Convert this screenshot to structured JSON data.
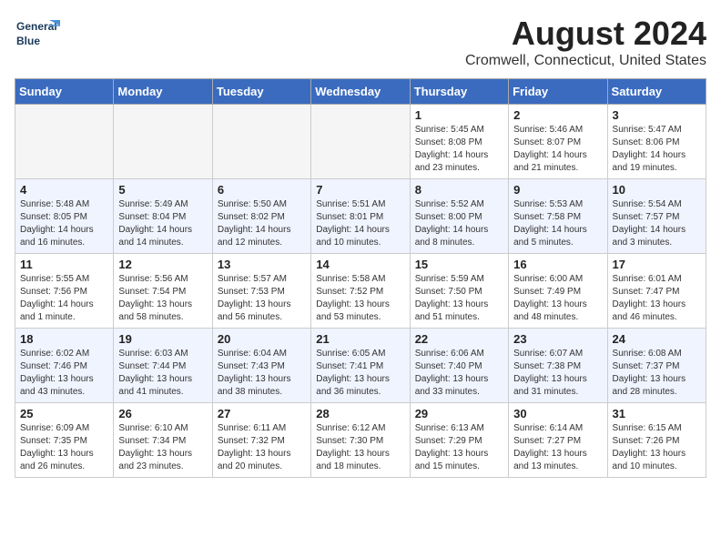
{
  "header": {
    "logo_line1": "General",
    "logo_line2": "Blue",
    "month_year": "August 2024",
    "location": "Cromwell, Connecticut, United States"
  },
  "weekdays": [
    "Sunday",
    "Monday",
    "Tuesday",
    "Wednesday",
    "Thursday",
    "Friday",
    "Saturday"
  ],
  "weeks": [
    [
      {
        "day": "",
        "info": ""
      },
      {
        "day": "",
        "info": ""
      },
      {
        "day": "",
        "info": ""
      },
      {
        "day": "",
        "info": ""
      },
      {
        "day": "1",
        "info": "Sunrise: 5:45 AM\nSunset: 8:08 PM\nDaylight: 14 hours\nand 23 minutes."
      },
      {
        "day": "2",
        "info": "Sunrise: 5:46 AM\nSunset: 8:07 PM\nDaylight: 14 hours\nand 21 minutes."
      },
      {
        "day": "3",
        "info": "Sunrise: 5:47 AM\nSunset: 8:06 PM\nDaylight: 14 hours\nand 19 minutes."
      }
    ],
    [
      {
        "day": "4",
        "info": "Sunrise: 5:48 AM\nSunset: 8:05 PM\nDaylight: 14 hours\nand 16 minutes."
      },
      {
        "day": "5",
        "info": "Sunrise: 5:49 AM\nSunset: 8:04 PM\nDaylight: 14 hours\nand 14 minutes."
      },
      {
        "day": "6",
        "info": "Sunrise: 5:50 AM\nSunset: 8:02 PM\nDaylight: 14 hours\nand 12 minutes."
      },
      {
        "day": "7",
        "info": "Sunrise: 5:51 AM\nSunset: 8:01 PM\nDaylight: 14 hours\nand 10 minutes."
      },
      {
        "day": "8",
        "info": "Sunrise: 5:52 AM\nSunset: 8:00 PM\nDaylight: 14 hours\nand 8 minutes."
      },
      {
        "day": "9",
        "info": "Sunrise: 5:53 AM\nSunset: 7:58 PM\nDaylight: 14 hours\nand 5 minutes."
      },
      {
        "day": "10",
        "info": "Sunrise: 5:54 AM\nSunset: 7:57 PM\nDaylight: 14 hours\nand 3 minutes."
      }
    ],
    [
      {
        "day": "11",
        "info": "Sunrise: 5:55 AM\nSunset: 7:56 PM\nDaylight: 14 hours\nand 1 minute."
      },
      {
        "day": "12",
        "info": "Sunrise: 5:56 AM\nSunset: 7:54 PM\nDaylight: 13 hours\nand 58 minutes."
      },
      {
        "day": "13",
        "info": "Sunrise: 5:57 AM\nSunset: 7:53 PM\nDaylight: 13 hours\nand 56 minutes."
      },
      {
        "day": "14",
        "info": "Sunrise: 5:58 AM\nSunset: 7:52 PM\nDaylight: 13 hours\nand 53 minutes."
      },
      {
        "day": "15",
        "info": "Sunrise: 5:59 AM\nSunset: 7:50 PM\nDaylight: 13 hours\nand 51 minutes."
      },
      {
        "day": "16",
        "info": "Sunrise: 6:00 AM\nSunset: 7:49 PM\nDaylight: 13 hours\nand 48 minutes."
      },
      {
        "day": "17",
        "info": "Sunrise: 6:01 AM\nSunset: 7:47 PM\nDaylight: 13 hours\nand 46 minutes."
      }
    ],
    [
      {
        "day": "18",
        "info": "Sunrise: 6:02 AM\nSunset: 7:46 PM\nDaylight: 13 hours\nand 43 minutes."
      },
      {
        "day": "19",
        "info": "Sunrise: 6:03 AM\nSunset: 7:44 PM\nDaylight: 13 hours\nand 41 minutes."
      },
      {
        "day": "20",
        "info": "Sunrise: 6:04 AM\nSunset: 7:43 PM\nDaylight: 13 hours\nand 38 minutes."
      },
      {
        "day": "21",
        "info": "Sunrise: 6:05 AM\nSunset: 7:41 PM\nDaylight: 13 hours\nand 36 minutes."
      },
      {
        "day": "22",
        "info": "Sunrise: 6:06 AM\nSunset: 7:40 PM\nDaylight: 13 hours\nand 33 minutes."
      },
      {
        "day": "23",
        "info": "Sunrise: 6:07 AM\nSunset: 7:38 PM\nDaylight: 13 hours\nand 31 minutes."
      },
      {
        "day": "24",
        "info": "Sunrise: 6:08 AM\nSunset: 7:37 PM\nDaylight: 13 hours\nand 28 minutes."
      }
    ],
    [
      {
        "day": "25",
        "info": "Sunrise: 6:09 AM\nSunset: 7:35 PM\nDaylight: 13 hours\nand 26 minutes."
      },
      {
        "day": "26",
        "info": "Sunrise: 6:10 AM\nSunset: 7:34 PM\nDaylight: 13 hours\nand 23 minutes."
      },
      {
        "day": "27",
        "info": "Sunrise: 6:11 AM\nSunset: 7:32 PM\nDaylight: 13 hours\nand 20 minutes."
      },
      {
        "day": "28",
        "info": "Sunrise: 6:12 AM\nSunset: 7:30 PM\nDaylight: 13 hours\nand 18 minutes."
      },
      {
        "day": "29",
        "info": "Sunrise: 6:13 AM\nSunset: 7:29 PM\nDaylight: 13 hours\nand 15 minutes."
      },
      {
        "day": "30",
        "info": "Sunrise: 6:14 AM\nSunset: 7:27 PM\nDaylight: 13 hours\nand 13 minutes."
      },
      {
        "day": "31",
        "info": "Sunrise: 6:15 AM\nSunset: 7:26 PM\nDaylight: 13 hours\nand 10 minutes."
      }
    ]
  ]
}
